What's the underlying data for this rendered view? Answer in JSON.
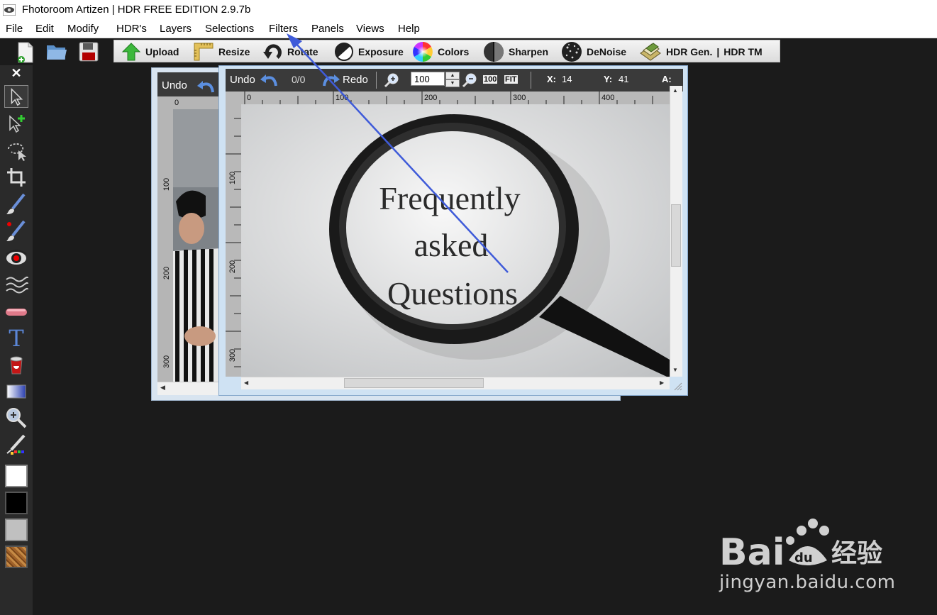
{
  "window": {
    "title": "Fhotoroom Artizen | HDR FREE EDITION 2.9.7b"
  },
  "menu": [
    {
      "label": "File"
    },
    {
      "label": "Edit"
    },
    {
      "label": "Modify"
    },
    {
      "label": "HDR's"
    },
    {
      "label": "Layers"
    },
    {
      "label": "Selections"
    },
    {
      "label": "Filters"
    },
    {
      "label": "Panels"
    },
    {
      "label": "Views"
    },
    {
      "label": "Help"
    }
  ],
  "toolbar": {
    "icons": [
      "new-document-icon",
      "open-folder-icon",
      "save-floppy-icon"
    ],
    "actions": [
      {
        "label": "Upload",
        "icon": "upload-arrow-icon"
      },
      {
        "label": "Resize",
        "icon": "ruler-icon"
      },
      {
        "label": "Rotate",
        "icon": "rotate-icon"
      },
      {
        "label": "Exposure",
        "icon": "exposure-icon"
      },
      {
        "label": "Colors",
        "icon": "color-wheel-icon"
      },
      {
        "label": "Sharpen",
        "icon": "sharpen-icon"
      },
      {
        "label": "DeNoise",
        "icon": "denoise-icon"
      },
      {
        "label": "HDR Gen.",
        "icon": "hdr-gen-icon"
      },
      {
        "label": "|"
      },
      {
        "label": "HDR TM"
      }
    ]
  },
  "tools": {
    "close": "✕",
    "items": [
      "select-arrow-icon",
      "add-selection-icon",
      "lasso-icon",
      "crop-icon",
      "brush-icon",
      "red-brush-icon",
      "red-eye-icon",
      "wave-filter-icon",
      "eraser-icon",
      "text-tool-icon",
      "paint-bucket-icon",
      "gradient-icon",
      "magnifier-icon",
      "color-picker-icon"
    ],
    "text_tool_glyph": "T",
    "swatches": [
      "#ffffff",
      "#000000",
      "#c0c0c0",
      "#a0622a"
    ]
  },
  "background_doc": {
    "undo_label": "Undo",
    "ruler_top": [
      "0"
    ],
    "ruler_left": [
      "100",
      "200",
      "300"
    ]
  },
  "document": {
    "undo_label": "Undo",
    "history": "0/0",
    "redo_label": "Redo",
    "zoom_value": "100",
    "zoom_100_label": "100",
    "fit_label": "FIT",
    "x_label": "X:",
    "x_value": "14",
    "y_label": "Y:",
    "y_value": "41",
    "a_label": "A:",
    "ruler_top": [
      "0",
      "100",
      "200",
      "300",
      "400"
    ],
    "ruler_left": [
      "100",
      "200",
      "300"
    ],
    "image_text": [
      "Frequently",
      "asked",
      "Questions"
    ]
  },
  "watermark": {
    "brand": "Bai du 经验",
    "url": "jingyan.baidu.com"
  },
  "colors": {
    "arrow": "#3f5bd9",
    "accent_window": "#cfe2f3"
  }
}
